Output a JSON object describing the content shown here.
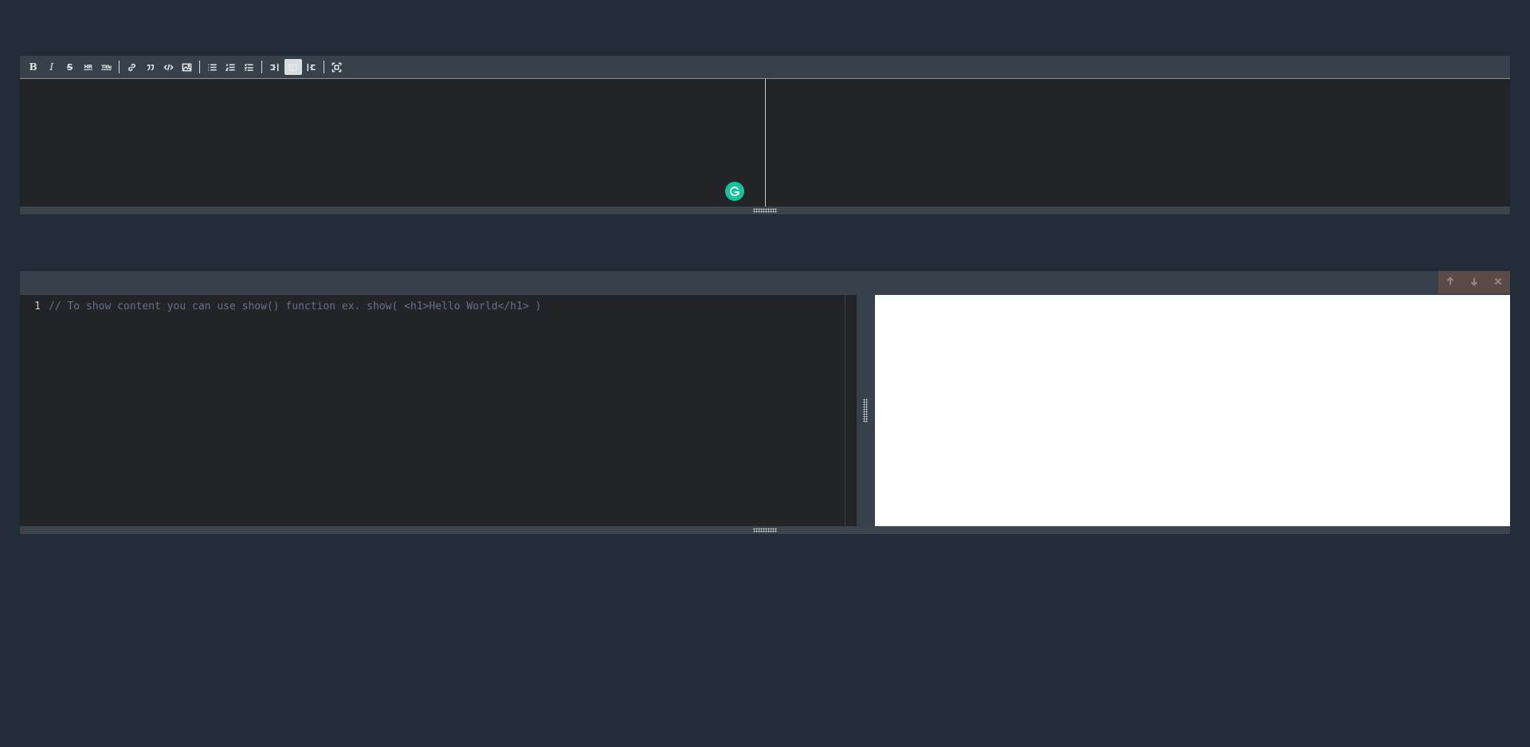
{
  "markdown_editor": {
    "toolbar": [
      {
        "type": "button",
        "name": "bold-button",
        "icon": "bold-icon",
        "label": "B"
      },
      {
        "type": "button",
        "name": "italic-button",
        "icon": "italic-icon",
        "label": "I"
      },
      {
        "type": "button",
        "name": "strikethrough-button",
        "icon": "strikethrough-icon",
        "label": "S"
      },
      {
        "type": "button",
        "name": "horizontal-rule-button",
        "icon": "hr-icon",
        "label": "HR"
      },
      {
        "type": "button",
        "name": "title-button",
        "icon": "title-icon",
        "label": "Title"
      },
      {
        "type": "separator"
      },
      {
        "type": "button",
        "name": "link-button",
        "icon": "link-icon"
      },
      {
        "type": "button",
        "name": "quote-button",
        "icon": "quote-icon"
      },
      {
        "type": "button",
        "name": "code-button",
        "icon": "code-icon"
      },
      {
        "type": "button",
        "name": "image-button",
        "icon": "image-icon"
      },
      {
        "type": "separator"
      },
      {
        "type": "button",
        "name": "unordered-list-button",
        "icon": "unordered-list-icon"
      },
      {
        "type": "button",
        "name": "ordered-list-button",
        "icon": "ordered-list-icon"
      },
      {
        "type": "button",
        "name": "checklist-button",
        "icon": "checklist-icon"
      },
      {
        "type": "separator"
      },
      {
        "type": "button",
        "name": "edit-mode-button",
        "icon": "edit-mode-icon"
      },
      {
        "type": "button",
        "name": "live-mode-button",
        "icon": "live-mode-icon",
        "active": true
      },
      {
        "type": "button",
        "name": "preview-mode-button",
        "icon": "preview-mode-icon"
      },
      {
        "type": "separator"
      },
      {
        "type": "button",
        "name": "fullscreen-button",
        "icon": "fullscreen-icon"
      }
    ]
  },
  "code_runner": {
    "header_buttons": [
      {
        "name": "move-up-button",
        "icon": "arrow-up-icon"
      },
      {
        "name": "move-down-button",
        "icon": "arrow-down-icon"
      },
      {
        "name": "close-button",
        "icon": "close-icon"
      }
    ],
    "lines": [
      {
        "number": "1",
        "text": "// To show content you can use show() function ex. show( <h1>Hello World</h1> )"
      }
    ]
  },
  "colors": {
    "background": "#212c38",
    "toolbar": "#37414c",
    "editor": "#222427",
    "grammarly": "#15c39a",
    "header_buttons": "#5b4b48",
    "comment": "#6b6f8a"
  }
}
